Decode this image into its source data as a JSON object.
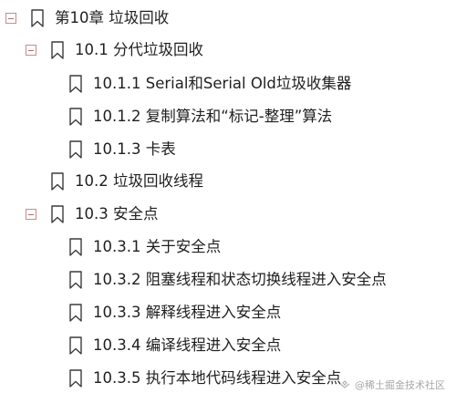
{
  "outline": {
    "chapter": {
      "label": "第10章 垃圾回收",
      "expanded": true
    },
    "sections": [
      {
        "label": "10.1 分代垃圾回收",
        "expanded": true,
        "items": [
          "10.1.1 Serial和Serial Old垃圾收集器",
          "10.1.2 复制算法和“标记-整理”算法",
          "10.1.3 卡表"
        ]
      },
      {
        "label": "10.2 垃圾回收线程"
      },
      {
        "label": "10.3 安全点",
        "expanded": true,
        "items": [
          "10.3.1 关于安全点",
          "10.3.2 阻塞线程和状态切换线程进入安全点",
          "10.3.3 解释线程进入安全点",
          "10.3.4 编译线程进入安全点",
          "10.3.5 执行本地代码线程进入安全点"
        ]
      }
    ]
  },
  "watermark": "@稀土掘金技术社区",
  "icons": {
    "toggle": "collapse-minus-icon",
    "bookmark": "bookmark-icon"
  },
  "colors": {
    "toggle_border": "#c88a8a",
    "toggle_minus": "#b56a6a",
    "bookmark_stroke": "#3b3b3b",
    "text": "#1f1f1f",
    "watermark": "#a7a7a7"
  }
}
